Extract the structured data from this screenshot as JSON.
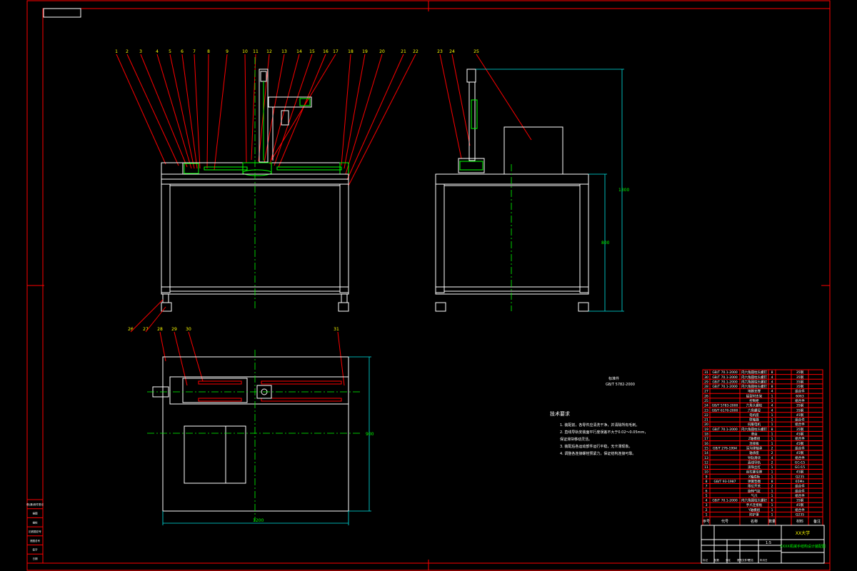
{
  "drawing": {
    "title_block": {
      "org": "XX大学",
      "drawing_name": "XXXX机械手结构设计装配图",
      "sheet_labels": [
        "标记",
        "处数",
        "分区",
        "更改文件号",
        "签名",
        "年月日"
      ],
      "scale_label": "1:5"
    },
    "top_callouts": [
      "1",
      "2",
      "3",
      "4",
      "5",
      "6",
      "7",
      "8",
      "9",
      "10",
      "11",
      "12",
      "13",
      "14",
      "15",
      "16",
      "17",
      "18",
      "19",
      "20",
      "21",
      "22"
    ],
    "side_callouts": [
      "23",
      "24",
      "25"
    ],
    "bottom_left_callouts": [
      "26",
      "27",
      "28",
      "29",
      "30"
    ],
    "plan_callout_right": "31",
    "section_note": [
      "标准件",
      "GB/T 5782-2000"
    ],
    "tech_requirements": {
      "heading": "技术要求",
      "items": [
        "1. 装配前，各零件应清洗干净，并清除所有毛刺。",
        "2. 直线导轨安装面平行度误差不大于0.02～0.05mm，",
        "   保证滑块移动灵活。",
        "3. 装配后各运动部件运行平稳，无卡滞现象。",
        "4. 调整各连接螺栓预紧力，保证结构连接可靠。"
      ]
    },
    "dimensions": {
      "side_total_height": "1300",
      "side_table_height": "800",
      "plan_depth": "900",
      "plan_width": "1200"
    },
    "left_strip": [
      "借(通)用件登记",
      "描图",
      "描校",
      "旧底图总号",
      "底图总号",
      "签字",
      "日期"
    ],
    "bom_headers": [
      "序号",
      "代号",
      "名称",
      "数量",
      "材料",
      "备注"
    ],
    "bom_rows": [
      [
        "31",
        "GB/T 70.1-2000",
        "内六角圆柱头螺钉",
        "8",
        "35钢"
      ],
      [
        "30",
        "GB/T 70.1-2000",
        "内六角圆柱头螺钉",
        "4",
        "35钢"
      ],
      [
        "29",
        "GB/T 70.1-2000",
        "内六角圆柱头螺钉",
        "4",
        "35钢"
      ],
      [
        "28",
        "GB/T 70.1-2000",
        "内六角圆柱头螺钉",
        "8",
        "35钢"
      ],
      [
        "27",
        "",
        "地脚支撑",
        "4",
        "组合件"
      ],
      [
        "26",
        "",
        "铝型材支架",
        "1",
        "6063"
      ],
      [
        "25",
        "",
        "控制柜",
        "1",
        "组合件"
      ],
      [
        "24",
        "GB/T 5783-2000",
        "六角头螺栓",
        "4",
        "35钢"
      ],
      [
        "23",
        "GB/T 6170-2000",
        "六角螺母",
        "4",
        "35钢"
      ],
      [
        "22",
        "",
        "电机座",
        "1",
        "45钢"
      ],
      [
        "21",
        "",
        "联轴器",
        "1",
        "组合件"
      ],
      [
        "20",
        "",
        "伺服电机",
        "1",
        "组合件"
      ],
      [
        "19",
        "GB/T 70.1-2000",
        "内六角圆柱头螺钉",
        "8",
        "35钢"
      ],
      [
        "18",
        "",
        "滑台",
        "1",
        "45钢"
      ],
      [
        "17",
        "",
        "Z轴模组",
        "1",
        "组合件"
      ],
      [
        "16",
        "",
        "连接板",
        "1",
        "45钢"
      ],
      [
        "15",
        "GB/T 276-1994",
        "深沟球轴承",
        "2",
        "组合件"
      ],
      [
        "14",
        "",
        "轴承座",
        "2",
        "45钢"
      ],
      [
        "13",
        "",
        "导轨滑块",
        "4",
        "组合件"
      ],
      [
        "12",
        "",
        "直线导轨",
        "2",
        "GCr15"
      ],
      [
        "11",
        "",
        "滚珠丝杠",
        "1",
        "GCr15"
      ],
      [
        "10",
        "",
        "丝杠螺母座",
        "1",
        "45钢"
      ],
      [
        "9",
        "",
        "X轴底板",
        "1",
        "Q235"
      ],
      [
        "8",
        "GB/T 93-1987",
        "弹簧垫圈",
        "8",
        "65Mn"
      ],
      [
        "7",
        "",
        "限位开关",
        "2",
        "组合件"
      ],
      [
        "6",
        "",
        "旋转气缸",
        "1",
        "组合件"
      ],
      [
        "5",
        "",
        "气爪",
        "1",
        "组合件"
      ],
      [
        "4",
        "GB/T 70.1-2000",
        "内六角圆柱头螺钉",
        "6",
        "35钢"
      ],
      [
        "3",
        "",
        "手爪连接板",
        "1",
        "45钢"
      ],
      [
        "2",
        "",
        "Y轴模组",
        "1",
        "组合件"
      ],
      [
        "1",
        "",
        "防护罩",
        "1",
        "Q235"
      ]
    ]
  }
}
